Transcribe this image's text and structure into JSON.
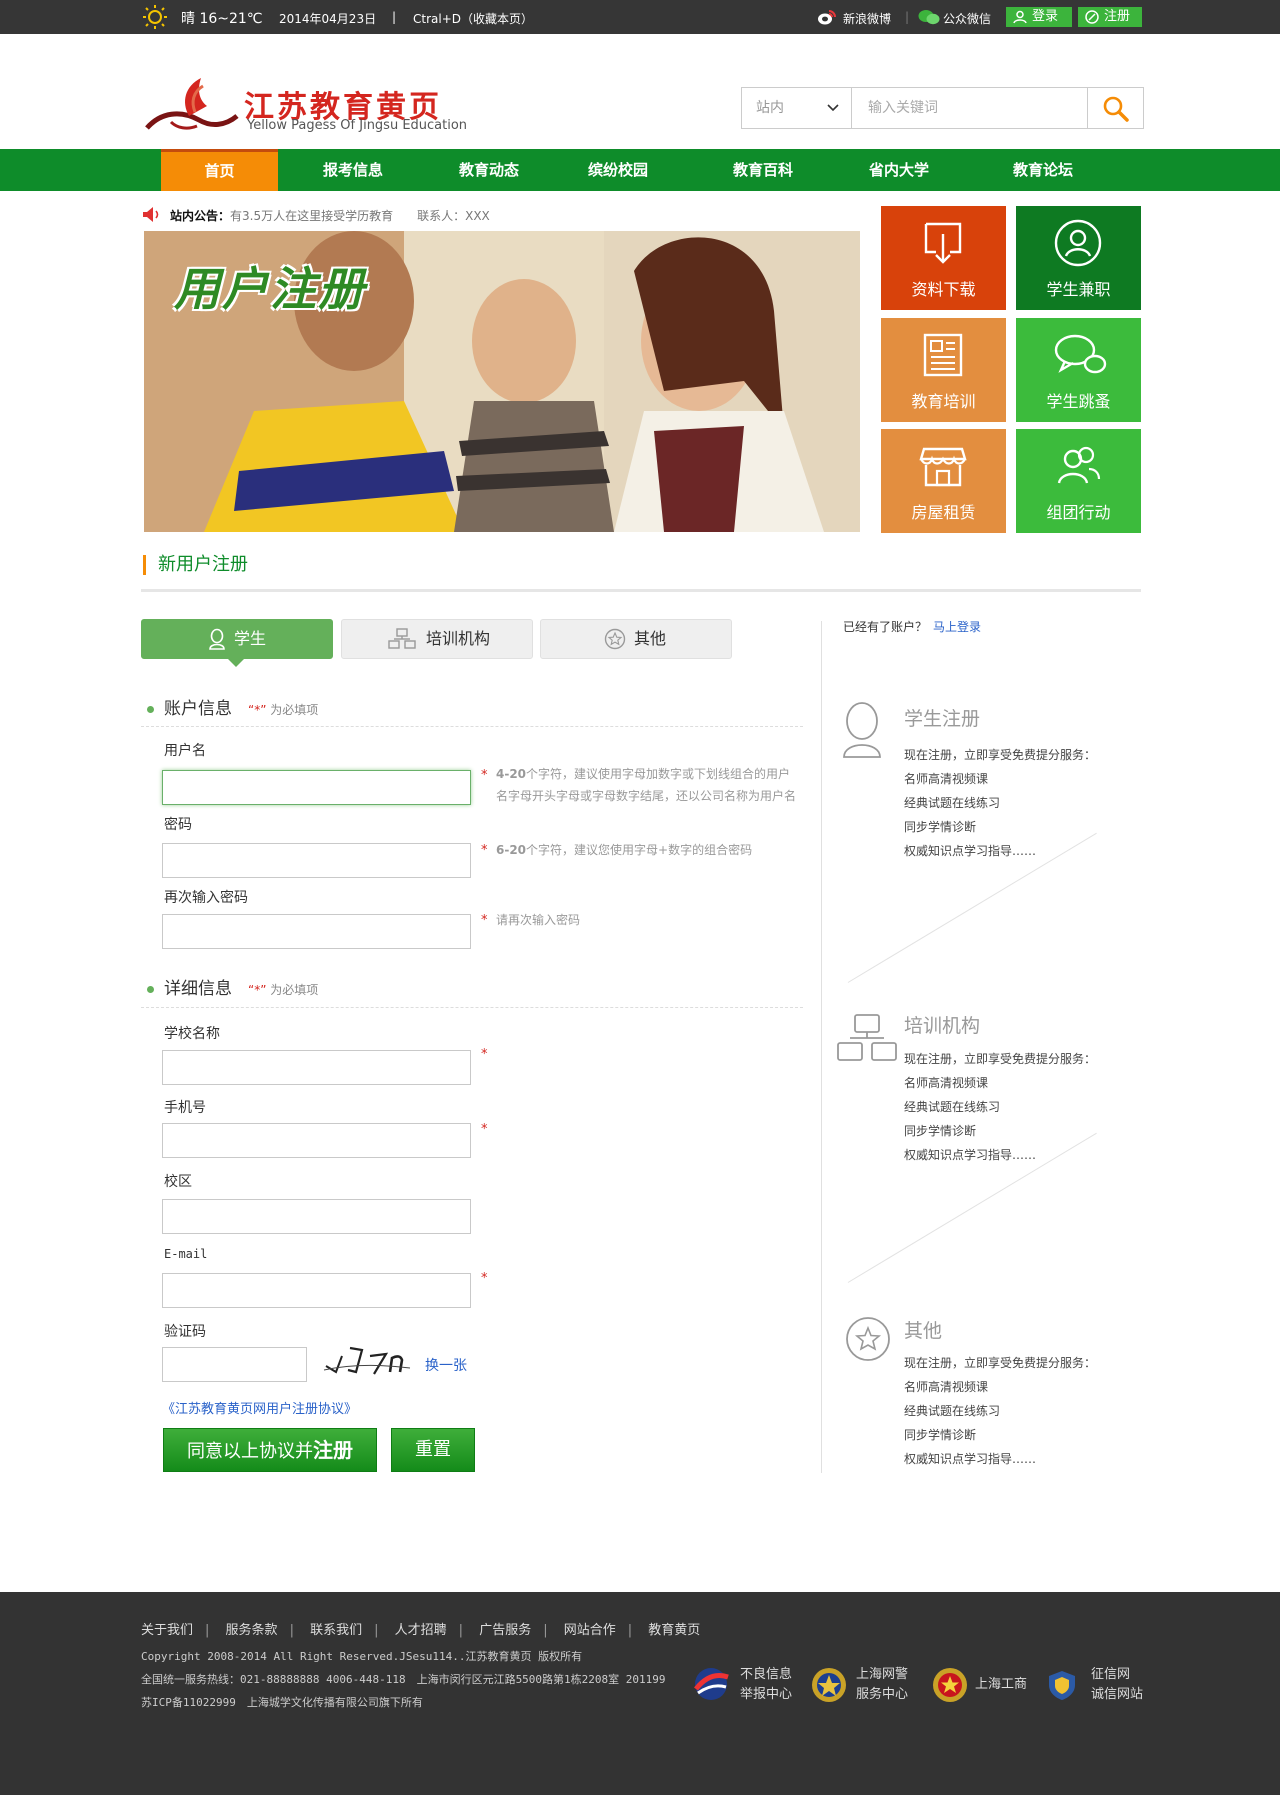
{
  "topbar": {
    "weather": "晴 16~21℃",
    "date": "2014年04月23日",
    "sep": "|",
    "bookmark": "Ctral+D（收藏本页）",
    "weibo": "新浪微博",
    "wechat": "公众微信",
    "login": "登录",
    "register": "注册"
  },
  "header": {
    "logo_title": "江苏教育黄页",
    "logo_subtitle": "Yellow Pagess Of Jingsu Education",
    "search_scope": "站内",
    "search_placeholder": "输入关键词"
  },
  "nav": {
    "items": [
      "首页",
      "报考信息",
      "教育动态",
      "缤纷校园",
      "教育百科",
      "省内大学",
      "教育论坛"
    ]
  },
  "notice": {
    "label": "站内公告：",
    "text": "有3.5万人在这里接受学历教育　　联系人：XXX"
  },
  "banner": {
    "title": "用户注册"
  },
  "tiles": [
    {
      "label": "资料下载",
      "color": "#d8420b"
    },
    {
      "label": "学生兼职",
      "color": "#0e7a22"
    },
    {
      "label": "教育培训",
      "color": "#e38e3f"
    },
    {
      "label": "学生跳蚤",
      "color": "#3cbb3c"
    },
    {
      "label": "房屋租赁",
      "color": "#e38e3f"
    },
    {
      "label": "组团行动",
      "color": "#3cbb3c"
    }
  ],
  "section": {
    "title": "新用户注册"
  },
  "tabs": [
    "学生",
    "培训机构",
    "其他"
  ],
  "form": {
    "account_group": "账户信息",
    "detail_group": "详细信息",
    "required_mark": "“*”",
    "required_text": "为必填项",
    "username_label": "用户名",
    "username_hint_bold": "4-20",
    "username_hint": "个字符，建议使用字母加数字或下划线组合的用户名字母开头字母或字母数字结尾，还以公司名称为用户名",
    "password_label": "密码",
    "password_hint_bold": "6-20",
    "password_hint": "个字符，建议您使用字母+数字的组合密码",
    "password2_label": "再次输入密码",
    "password2_hint": "请再次输入密码",
    "school_label": "学校名称",
    "phone_label": "手机号",
    "campus_label": "校区",
    "email_label": "E-mail",
    "captcha_label": "验证码",
    "captcha_text": "uJ7n",
    "captcha_refresh": "换一张",
    "agreement": "《江苏教育黄页网用户注册协议》",
    "submit_prefix": "同意以上协议并",
    "submit_bold": "注册",
    "reset": "重置"
  },
  "side": {
    "have_account": "已经有了账户？",
    "login_link": "马上登录",
    "blocks": [
      {
        "title": "学生注册",
        "items": [
          "现在注册，立即享受免费提分服务：",
          "名师高清视频课",
          "经典试题在线练习",
          "同步学情诊断",
          "权威知识点学习指导……"
        ]
      },
      {
        "title": "培训机构",
        "items": [
          "现在注册，立即享受免费提分服务：",
          "名师高清视频课",
          "经典试题在线练习",
          "同步学情诊断",
          "权威知识点学习指导……"
        ]
      },
      {
        "title": "其他",
        "items": [
          "现在注册，立即享受免费提分服务：",
          "名师高清视频课",
          "经典试题在线练习",
          "同步学情诊断",
          "权威知识点学习指导……"
        ]
      }
    ]
  },
  "footer": {
    "links": [
      "关于我们",
      "服务条款",
      "联系我们",
      "人才招聘",
      "广告服务",
      "网站合作",
      "教育黄页"
    ],
    "copyright": "Copyright 2008-2014 All Right Reserved.JSesu114..江苏教育黄页 版权所有",
    "hotline": "全国统一服务热线：021-88888888 4006-448-118　上海市闵行区元江路5500路第1栋2208室 201199",
    "icp": "苏ICP备11022999　上海城学文化传播有限公司旗下所有",
    "badges": [
      {
        "line1": "不良信息",
        "line2": "举报中心"
      },
      {
        "line1": "上海网警",
        "line2": "服务中心"
      },
      {
        "line1": "上海工商",
        "line2": ""
      },
      {
        "line1": "征信网",
        "line2": "诚信网站"
      }
    ]
  }
}
